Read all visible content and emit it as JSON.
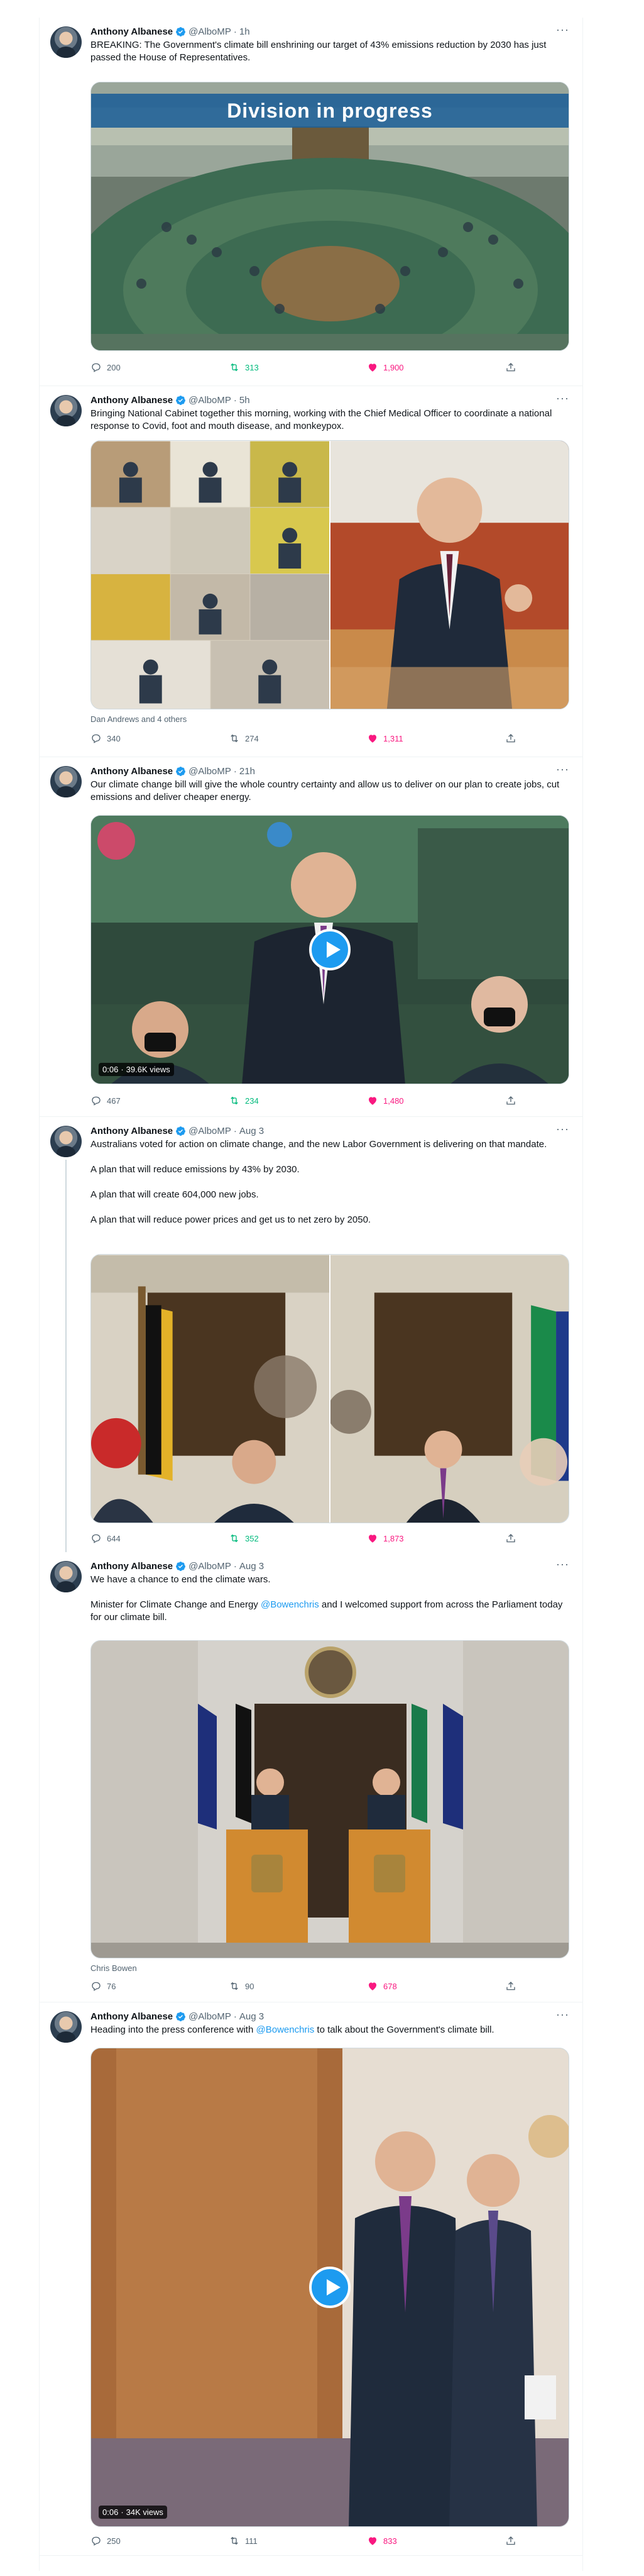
{
  "author": {
    "name": "Anthony Albanese",
    "handle": "@AlboMP"
  },
  "colors": {
    "verified": "#1d9bf0",
    "retweeted": "#00ba7c",
    "liked": "#f91880",
    "link": "#1d9bf0"
  },
  "tweets": [
    {
      "time": "1h",
      "text": [
        "BREAKING: The Government's climate bill enshrining our target of 43% emissions reduction by 2030 has just passed the House of Representatives."
      ],
      "media_banner": "Division in progress",
      "replies": "200",
      "retweets": "313",
      "likes": "1,900"
    },
    {
      "time": "5h",
      "text": [
        "Bringing National Cabinet together this morning, working with the Chief Medical Officer to coordinate a national response to Covid, foot and mouth disease, and monkeypox."
      ],
      "caption": "Dan Andrews and 4 others",
      "replies": "340",
      "retweets": "274",
      "likes": "1,311"
    },
    {
      "time": "21h",
      "text": [
        "Our climate change bill will give the whole country certainty and allow us to deliver on our plan to create jobs, cut emissions and deliver cheaper energy."
      ],
      "video_time": "0:06",
      "video_views": "39.6K views",
      "replies": "467",
      "retweets": "234",
      "likes": "1,480"
    },
    {
      "time": "Aug 3",
      "text": [
        "Australians voted for action on climate change, and the new Labor Government is delivering on that mandate.",
        "A plan that will reduce emissions by 43% by 2030.",
        "A plan that will create 604,000 new jobs.",
        "A plan that will reduce power prices and get us to net zero by 2050."
      ],
      "replies": "644",
      "retweets": "352",
      "likes": "1,873"
    },
    {
      "time": "Aug 3",
      "text_a": "We have a chance to end the climate wars.",
      "text_b_pre": "Minister for Climate Change and Energy ",
      "text_b_link": "@Bowenchris",
      "text_b_post": " and I welcomed support from across the Parliament today for our climate bill.",
      "caption": "Chris Bowen",
      "replies": "76",
      "retweets": "90",
      "likes": "678"
    },
    {
      "time": "Aug 3",
      "text_pre": "Heading into the press conference with ",
      "text_link": "@Bowenchris",
      "text_post": " to talk about the Government's climate bill.",
      "video_time": "0:06",
      "video_views": "34K views",
      "replies": "250",
      "retweets": "111",
      "likes": "833"
    }
  ]
}
